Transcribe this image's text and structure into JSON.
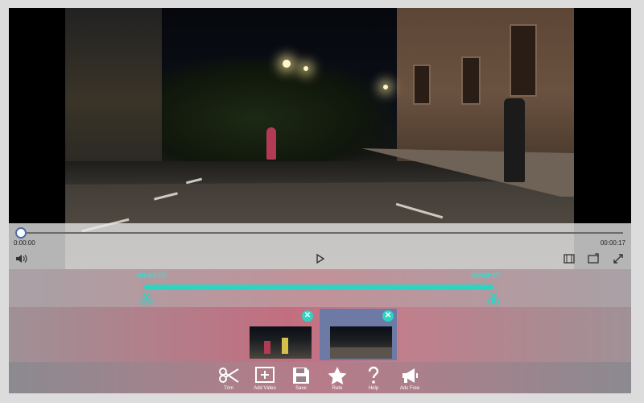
{
  "player": {
    "current_time": "0:00:00",
    "total_time": "00:00:17",
    "progress_fraction": 0.0
  },
  "trim": {
    "start_label": "00:00:00",
    "end_label": "00:00:17"
  },
  "clips": [
    {
      "remove_icon": "close-icon",
      "selected": false
    },
    {
      "remove_icon": "close-icon",
      "selected": true
    }
  ],
  "toolbar": {
    "items": [
      {
        "label": "Trim",
        "icon": "scissors-icon"
      },
      {
        "label": "Add Video",
        "icon": "add-video-icon"
      },
      {
        "label": "Save",
        "icon": "save-icon"
      },
      {
        "label": "Rate",
        "icon": "star-icon"
      },
      {
        "label": "Help",
        "icon": "help-icon"
      },
      {
        "label": "Ads Free",
        "icon": "megaphone-icon"
      }
    ]
  },
  "colors": {
    "accent": "#2ed3c2",
    "selected_clip": "#6d7aa6"
  }
}
